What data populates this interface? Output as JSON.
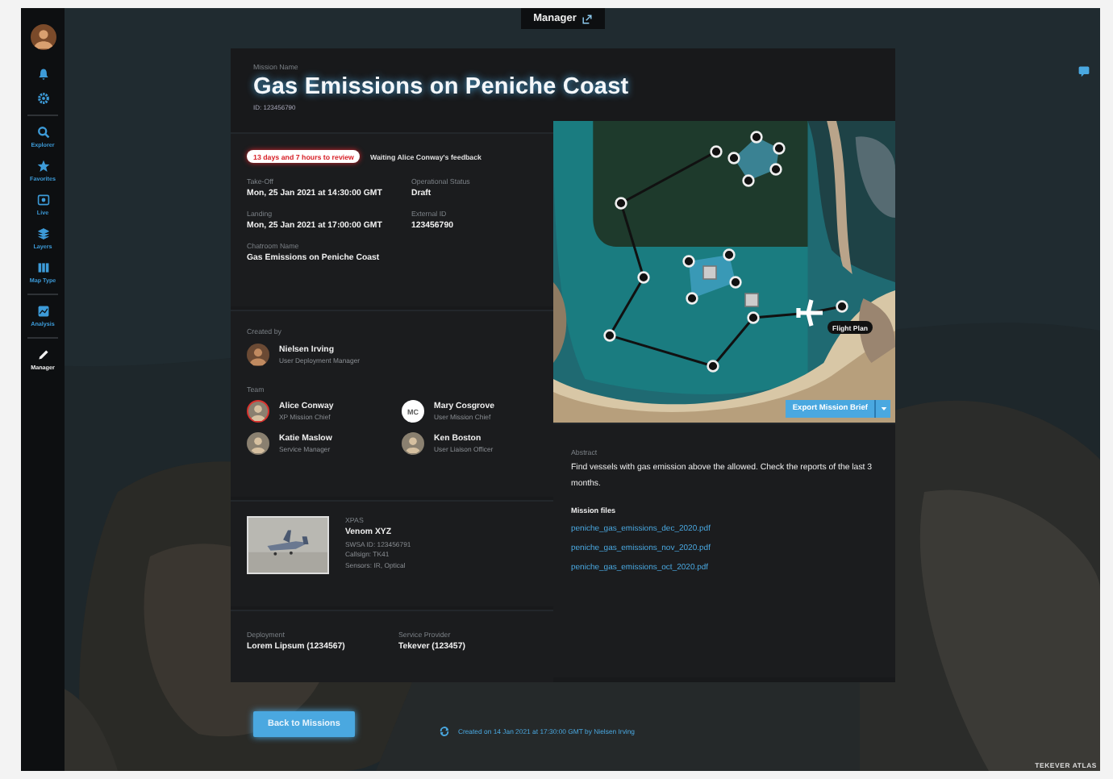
{
  "top_tab": {
    "label": "Manager"
  },
  "sidebar": {
    "items": [
      {
        "kind": "avatar",
        "selected": false
      },
      {
        "kind": "bell",
        "selected": false
      },
      {
        "kind": "gear",
        "selected": false
      },
      {
        "kind": "divider"
      },
      {
        "kind": "search",
        "label": "Explorer",
        "selected": false
      },
      {
        "kind": "star",
        "label": "Favorites",
        "selected": false
      },
      {
        "kind": "live",
        "label": "Live",
        "selected": false
      },
      {
        "kind": "layers",
        "label": "Layers",
        "selected": false
      },
      {
        "kind": "maptype",
        "label": "Map Type",
        "selected": false
      },
      {
        "kind": "divider"
      },
      {
        "kind": "analysis",
        "label": "Analysis",
        "selected": false
      },
      {
        "kind": "divider"
      },
      {
        "kind": "pencil",
        "label": "Manager",
        "selected": true
      }
    ]
  },
  "mission": {
    "label": "Mission Name",
    "title": "Gas Emissions on Peniche Coast",
    "id": "ID: 123456790"
  },
  "status": {
    "deadline": "13 days and 7 hours to review",
    "waiting": "Waiting Alice Conway's feedback"
  },
  "fields": [
    {
      "label": "Take-Off",
      "value": "Mon, 25 Jan 2021 at 14:30:00 GMT"
    },
    {
      "label": "Operational Status",
      "value": "Draft"
    },
    {
      "label": "Landing",
      "value": "Mon, 25 Jan 2021 at 17:00:00 GMT"
    },
    {
      "label": "External ID",
      "value": "123456790"
    },
    {
      "label": "Chatroom Name",
      "value": "Gas Emissions on Peniche Coast"
    }
  ],
  "created_by": {
    "label": "Created by",
    "name": "Nielsen Irving",
    "role": "User Deployment Manager"
  },
  "team": {
    "label": "Team",
    "members": [
      {
        "name": "Alice Conway",
        "role": "XP Mission Chief",
        "highlighted": true
      },
      {
        "name": "Mary Cosgrove",
        "role": "User Mission Chief",
        "kind": "initials",
        "initials": "MC",
        "highlighted": false
      },
      {
        "name": "Katie Maslow",
        "role": "Service Manager",
        "highlighted": false
      },
      {
        "name": "Ken Boston",
        "role": "User Liaison Officer",
        "highlighted": false
      }
    ]
  },
  "vehicle": {
    "type": "XPAS",
    "name": "Venom XYZ",
    "details": [
      "SWSA ID: 123456791",
      "Callsign: TK41",
      "Sensors: IR, Optical"
    ]
  },
  "assignment": [
    {
      "label": "Deployment",
      "value": "Lorem Lipsum (1234567)"
    },
    {
      "label": "Service Provider",
      "value": "Tekever (123457)"
    }
  ],
  "map": {
    "route_label": "Flight Plan",
    "export_button": "Export Mission Brief"
  },
  "abstract": {
    "label": "Abstract",
    "text": "Find vessels with gas emission above the allowed. Check the reports of the last 3 months.",
    "files_label": "Mission files",
    "files": [
      "peniche_gas_emissions_dec_2020.pdf",
      "peniche_gas_emissions_nov_2020.pdf",
      "peniche_gas_emissions_oct_2020.pdf"
    ]
  },
  "back_button": "Back to Missions",
  "footer": "Created on 14 Jan 2021 at 17:30:00 GMT by Nielsen Irving",
  "brand": "TEKEVER ATLAS"
}
